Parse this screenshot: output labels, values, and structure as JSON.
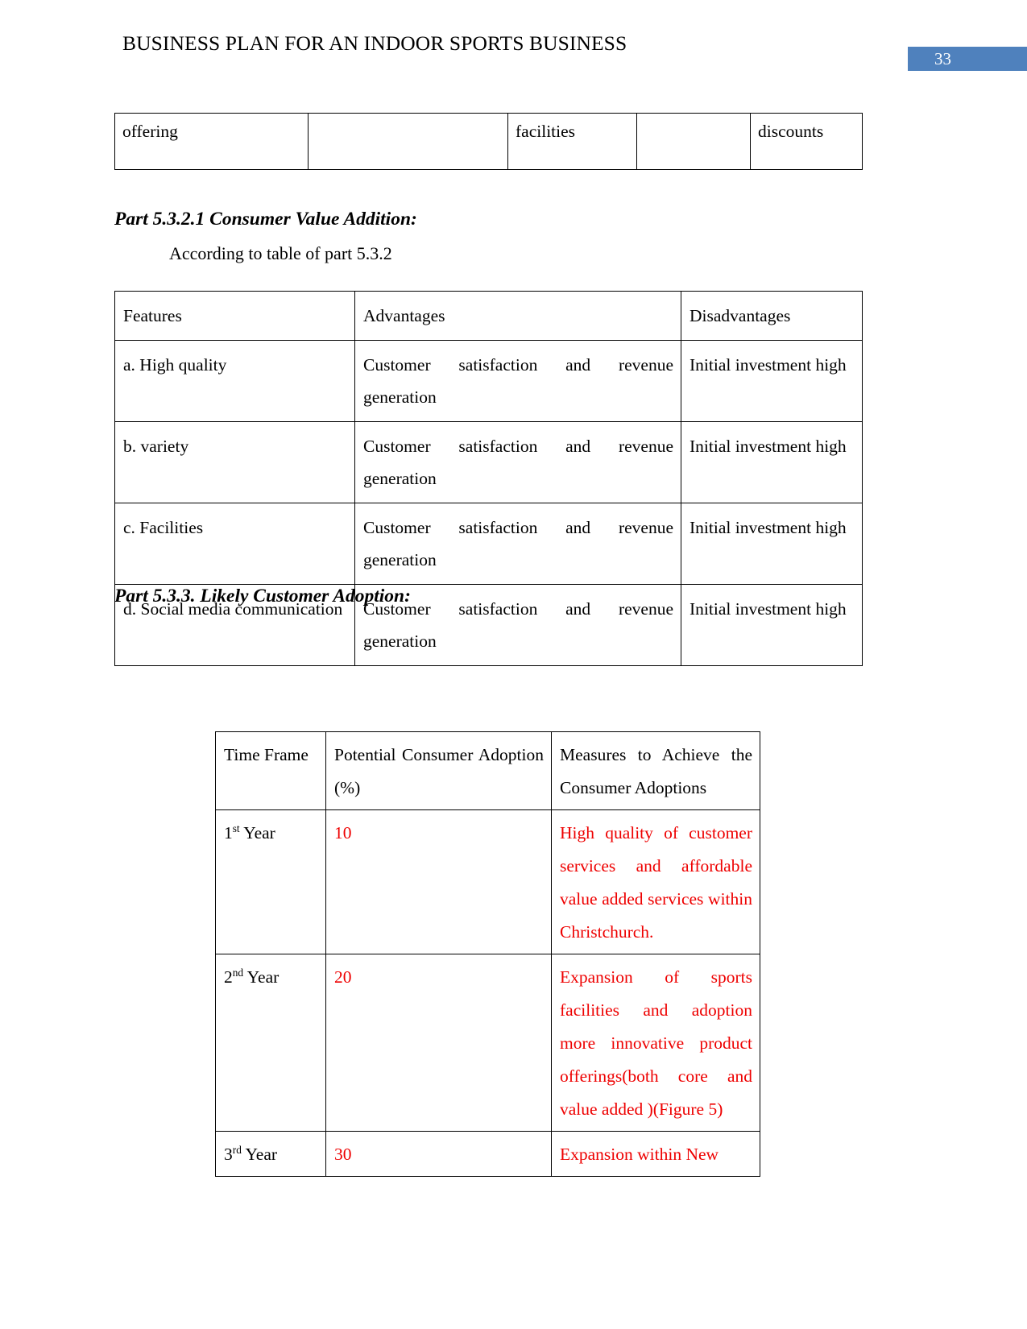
{
  "header": {
    "title": "BUSINESS PLAN FOR AN INDOOR SPORTS BUSINESS",
    "page_number": "33",
    "badge_color": "#4f81bd"
  },
  "colors": {
    "red_text": "#ee0000",
    "table_border": "#000000",
    "body_text": "#000000"
  },
  "fragment_table": {
    "cells": [
      "offering",
      "",
      "facilities",
      "",
      "discounts"
    ]
  },
  "section_5_3_2_1": {
    "heading": "Part 5.3.2.1 Consumer Value Addition:",
    "intro": "According to table of part 5.3.2"
  },
  "features_table": {
    "headers": [
      "Features",
      "Advantages",
      "Disadvantages"
    ],
    "rows": [
      {
        "feature": "a. High quality",
        "advantage": "Customer satisfaction and revenue generation",
        "disadvantage": "Initial investment high"
      },
      {
        "feature": "b. variety",
        "advantage": "Customer satisfaction and revenue generation",
        "disadvantage": "Initial investment high"
      },
      {
        "feature": "c. Facilities",
        "advantage": "Customer satisfaction and revenue generation",
        "disadvantage": "Initial investment high"
      },
      {
        "feature": "d. Social media communication",
        "advantage": "Customer satisfaction and revenue generation",
        "disadvantage": "Initial investment high"
      }
    ]
  },
  "section_5_3_3": {
    "heading": "Part 5.3.3. Likely Customer Adoption:"
  },
  "adoption_table": {
    "headers": [
      "Time Frame",
      "Potential Consumer Adoption (%)",
      "Measures to Achieve the Consumer Adoptions"
    ],
    "rows": [
      {
        "time_frame_num": "1",
        "time_frame_ord": "st",
        "time_frame_unit": "Year",
        "adoption_pct": "10",
        "measures": "High quality of customer services and affordable value added services within Christchurch."
      },
      {
        "time_frame_num": "2",
        "time_frame_ord": "nd",
        "time_frame_unit": "Year",
        "adoption_pct": "20",
        "measures": "Expansion of sports facilities and adoption more innovative product offerings(both core and value added )(Figure 5)"
      },
      {
        "time_frame_num": "3",
        "time_frame_ord": "rd",
        "time_frame_unit": "Year",
        "adoption_pct": "30",
        "measures": "Expansion within New"
      }
    ]
  }
}
